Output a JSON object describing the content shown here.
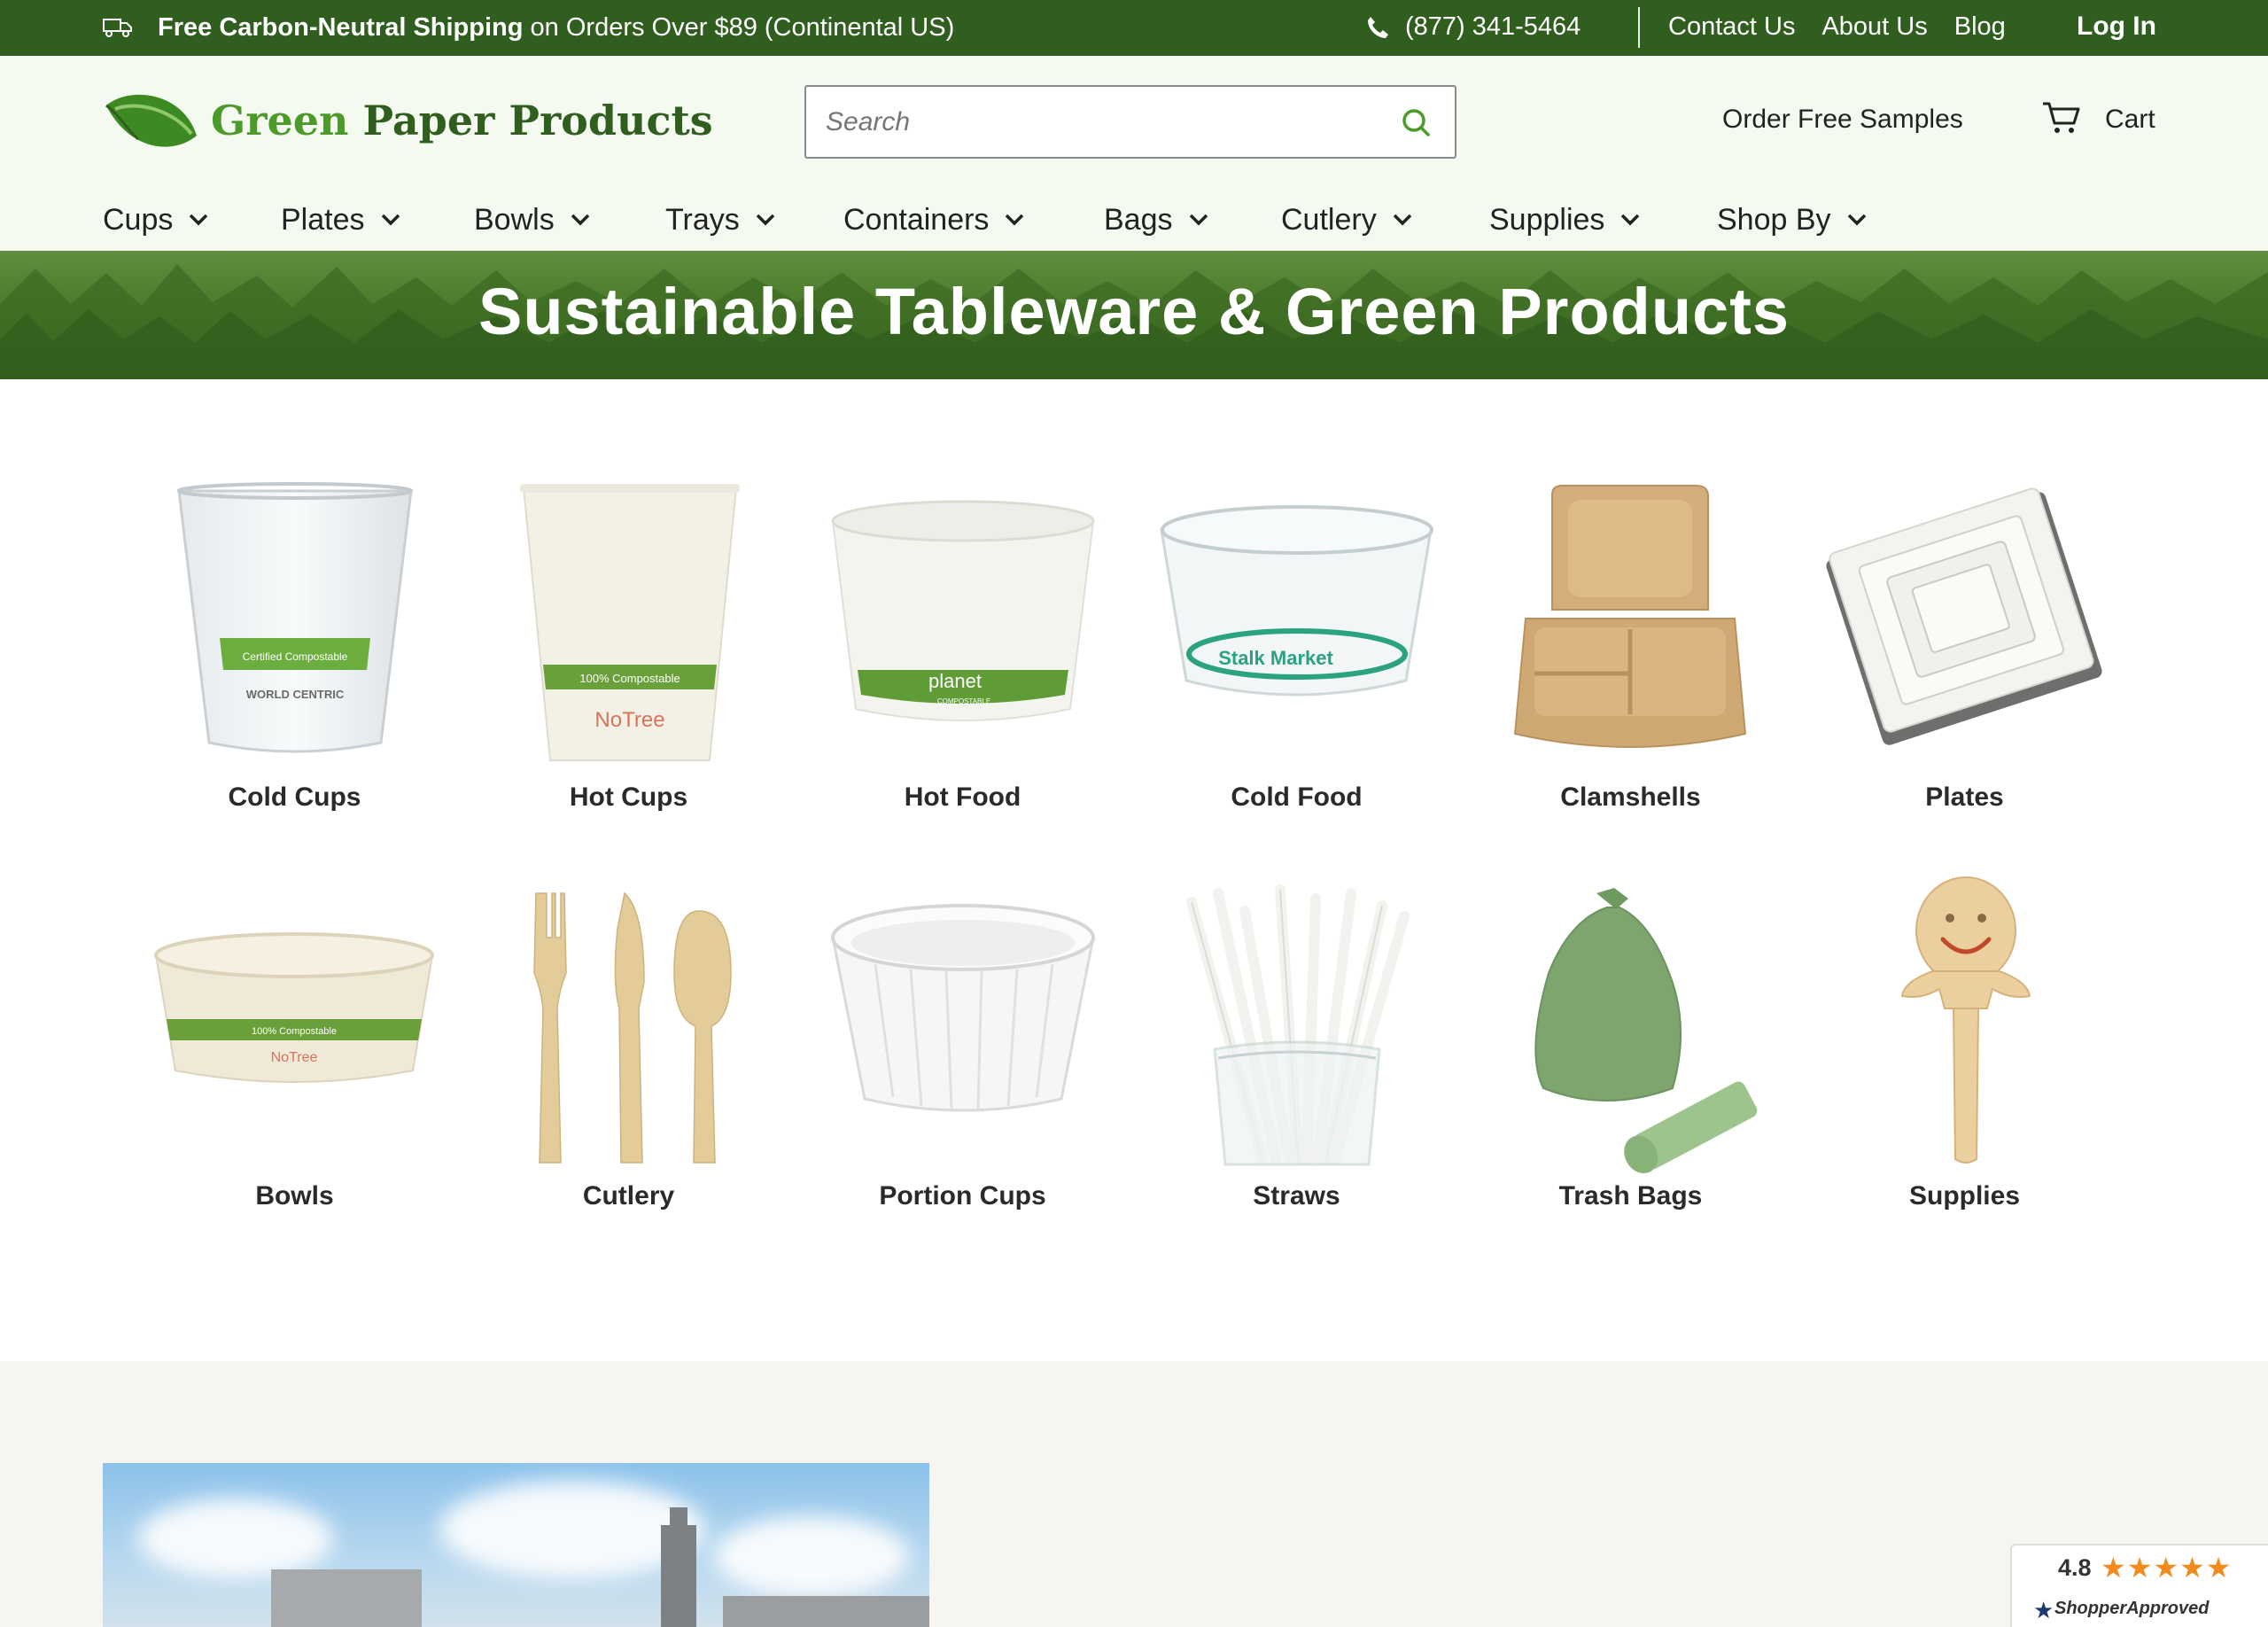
{
  "topbar": {
    "shipping_bold": "Free Carbon-Neutral Shipping",
    "shipping_rest": " on Orders Over $89 (Continental US)",
    "phone": "(877) 341-5464",
    "links": [
      "Contact Us",
      "About Us",
      "Blog"
    ],
    "login": "Log In"
  },
  "header": {
    "brand_part1": "Green",
    "brand_part2": " Paper Products",
    "search_placeholder": "Search",
    "order_samples": "Order Free Samples",
    "cart": "Cart"
  },
  "nav": {
    "items": [
      "Cups",
      "Plates",
      "Bowls",
      "Trays",
      "Containers",
      "Bags",
      "Cutlery",
      "Supplies",
      "Shop By"
    ]
  },
  "banner": {
    "title": "Sustainable Tableware & Green Products"
  },
  "categories": {
    "items": [
      "Cold Cups",
      "Hot Cups",
      "Hot Food",
      "Cold Food",
      "Clamshells",
      "Plates",
      "Bowls",
      "Cutlery",
      "Portion Cups",
      "Straws",
      "Trash Bags",
      "Supplies"
    ]
  },
  "product_print": {
    "cold_cup_band": "Certified Compostable",
    "cold_cup_brand": "WORLD CENTRIC",
    "hot_cup_band": "100% Compostable",
    "hot_cup_brand": "NoTree",
    "hot_food_brand": "planet",
    "hot_food_sub": "COMPOSTABLE",
    "cold_food_brand": "Stalk Market",
    "bowl_band": "100% Compostable",
    "bowl_brand": "NoTree"
  },
  "rating": {
    "score": "4.8",
    "stars": "★★★★★",
    "badge_part1": "Shopper",
    "badge_part2": "Approved"
  },
  "colors": {
    "topbar": "#2f5e1f",
    "header_bg": "#f4faef",
    "brand_light": "#4c9a2a",
    "brand_dark": "#2f5e1f",
    "banner": "#4f7f2e",
    "star": "#f28a1c"
  }
}
